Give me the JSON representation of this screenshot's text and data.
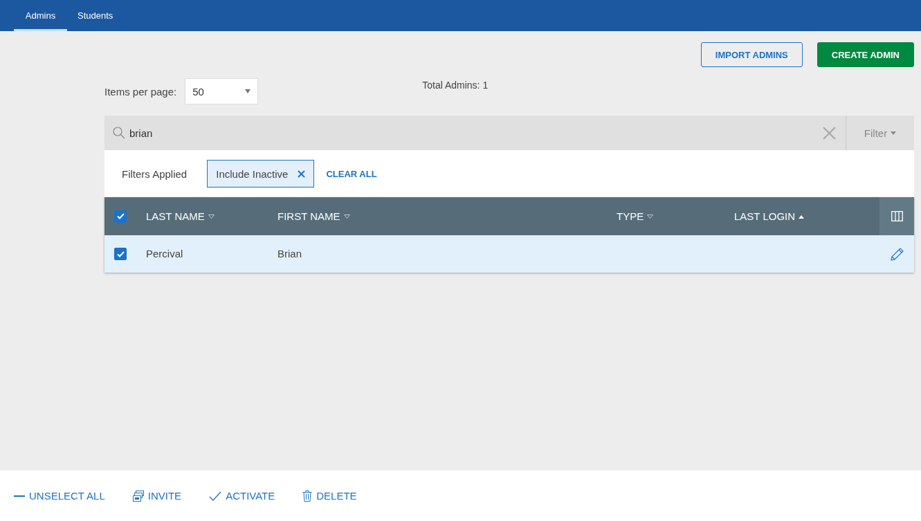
{
  "tabs": [
    {
      "label": "Admins",
      "selected": true
    },
    {
      "label": "Students",
      "selected": false
    }
  ],
  "header_buttons": [
    {
      "label": "IMPORT ADMINS",
      "kind": "outline"
    },
    {
      "label": "CREATE ADMIN",
      "kind": "primary"
    }
  ],
  "items_per_page": {
    "label": "Items per page:",
    "value": "50"
  },
  "total": "Total Admins: 1",
  "search": {
    "value": "brian"
  },
  "filter_button": "Filter",
  "filters": {
    "label": "Filters Applied",
    "chips": [
      "Include Inactive"
    ],
    "clear": "CLEAR ALL"
  },
  "table": {
    "all_checked": true,
    "columns": [
      {
        "label": "LAST NAME",
        "sorted": false
      },
      {
        "label": "FIRST NAME",
        "sorted": false
      },
      {
        "label": "TYPE",
        "sorted": false
      },
      {
        "label": "LAST LOGIN",
        "sorted": true
      }
    ],
    "rows": [
      {
        "checked": true,
        "cells": [
          "Percival",
          "Brian"
        ]
      }
    ]
  },
  "actions": [
    {
      "label": "UNSELECT ALL",
      "kind": "unselect"
    },
    {
      "label": "INVITE",
      "kind": "invite"
    },
    {
      "label": "ACTIVATE",
      "kind": "activate"
    },
    {
      "label": "DELETE",
      "kind": "delete"
    }
  ]
}
